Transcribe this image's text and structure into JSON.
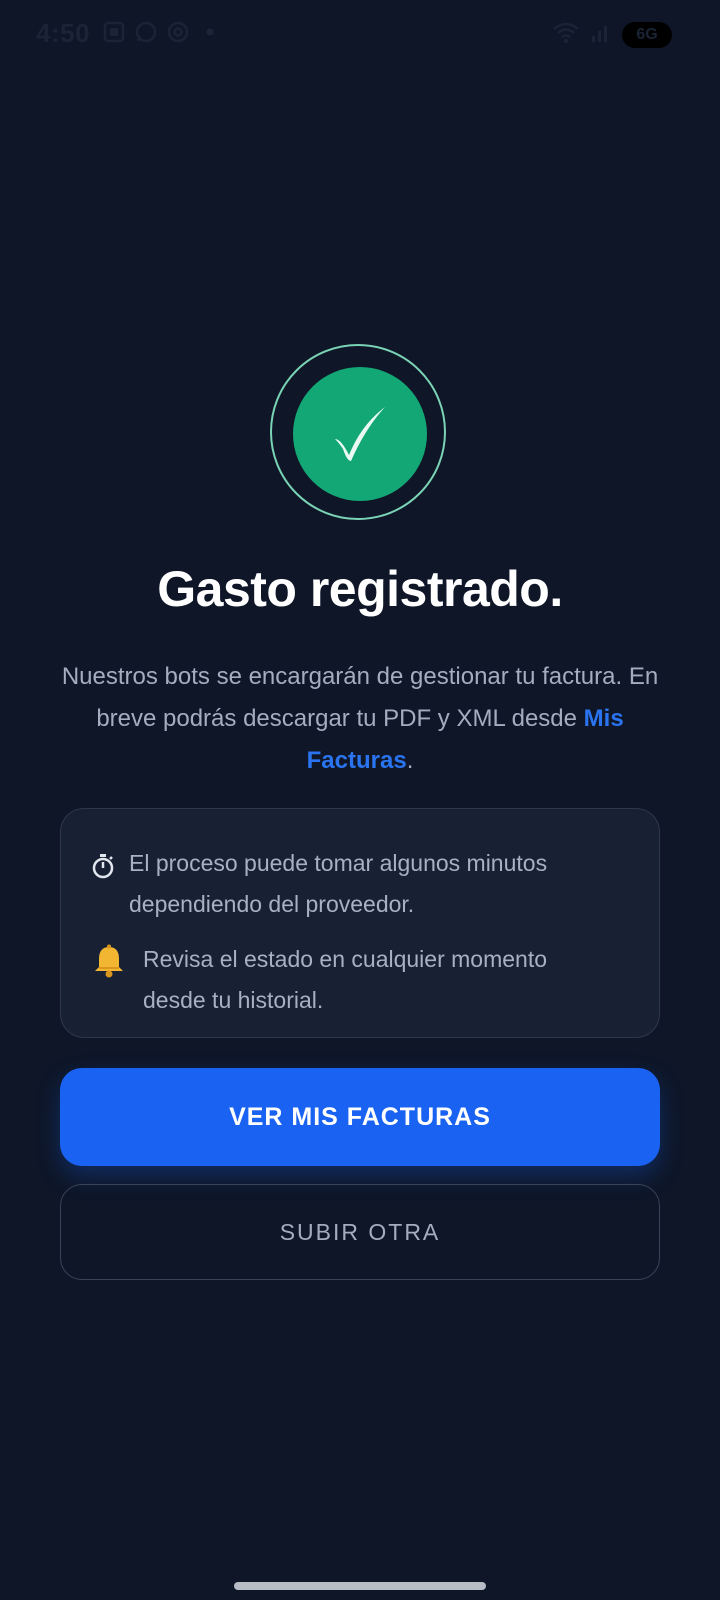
{
  "status_bar": {
    "time": "4:50",
    "network": "6G",
    "left_icons": [
      "screenshot-icon",
      "whatsapp-icon",
      "threads-icon",
      "dot-icon"
    ],
    "right_icons": [
      "wifi-icon",
      "signal-icon",
      "battery-icon"
    ]
  },
  "success": {
    "icon": "checkmark-icon",
    "accent_color": "#13a775",
    "ring_color": "#7ad3b4"
  },
  "title": "Gasto registrado.",
  "message": {
    "text_before": "Nuestros bots se encargarán de gestionar tu factura. En breve podrás descargar tu PDF y XML desde ",
    "link": "Mis Facturas",
    "text_after": ".",
    "link_color": "#2a74f0"
  },
  "info": {
    "items": [
      {
        "icon": "stopwatch-icon",
        "text": "El proceso puede tomar algunos minutos dependiendo del proveedor."
      },
      {
        "icon": "bell-icon",
        "text": "Revisa el estado en cualquier momento desde tu historial."
      }
    ]
  },
  "actions": {
    "primary_label": "VER MIS FACTURAS",
    "secondary_label": "SUBIR OTRA",
    "primary_color": "#1a63f2"
  }
}
